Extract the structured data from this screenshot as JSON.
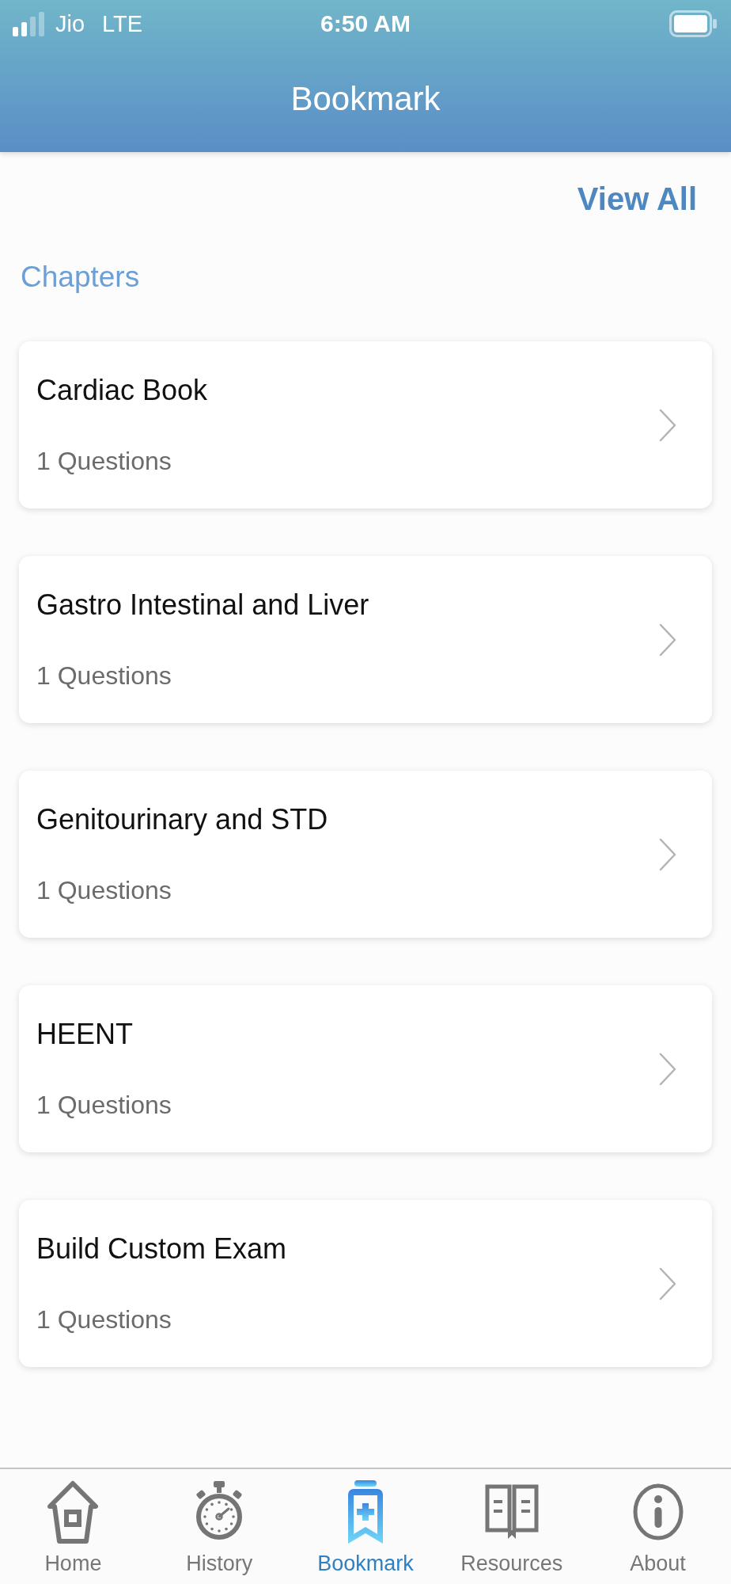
{
  "status_bar": {
    "carrier": "Jio",
    "network": "LTE",
    "time": "6:50 AM"
  },
  "header": {
    "title": "Bookmark"
  },
  "view_all": "View All",
  "section_title": "Chapters",
  "chapters": [
    {
      "title": "Cardiac Book",
      "count": "1 Questions"
    },
    {
      "title": "Gastro Intestinal and Liver",
      "count": "1 Questions"
    },
    {
      "title": "Genitourinary and STD",
      "count": "1 Questions"
    },
    {
      "title": "HEENT",
      "count": "1 Questions"
    },
    {
      "title": "Build Custom Exam",
      "count": "1 Questions"
    }
  ],
  "tab_bar": [
    {
      "kind": "home",
      "label": "Home",
      "selected": false
    },
    {
      "kind": "history",
      "label": "History",
      "selected": false
    },
    {
      "kind": "bookmark",
      "label": "Bookmark",
      "selected": true
    },
    {
      "kind": "resources",
      "label": "Resources",
      "selected": false
    },
    {
      "kind": "about",
      "label": "About",
      "selected": false
    }
  ]
}
